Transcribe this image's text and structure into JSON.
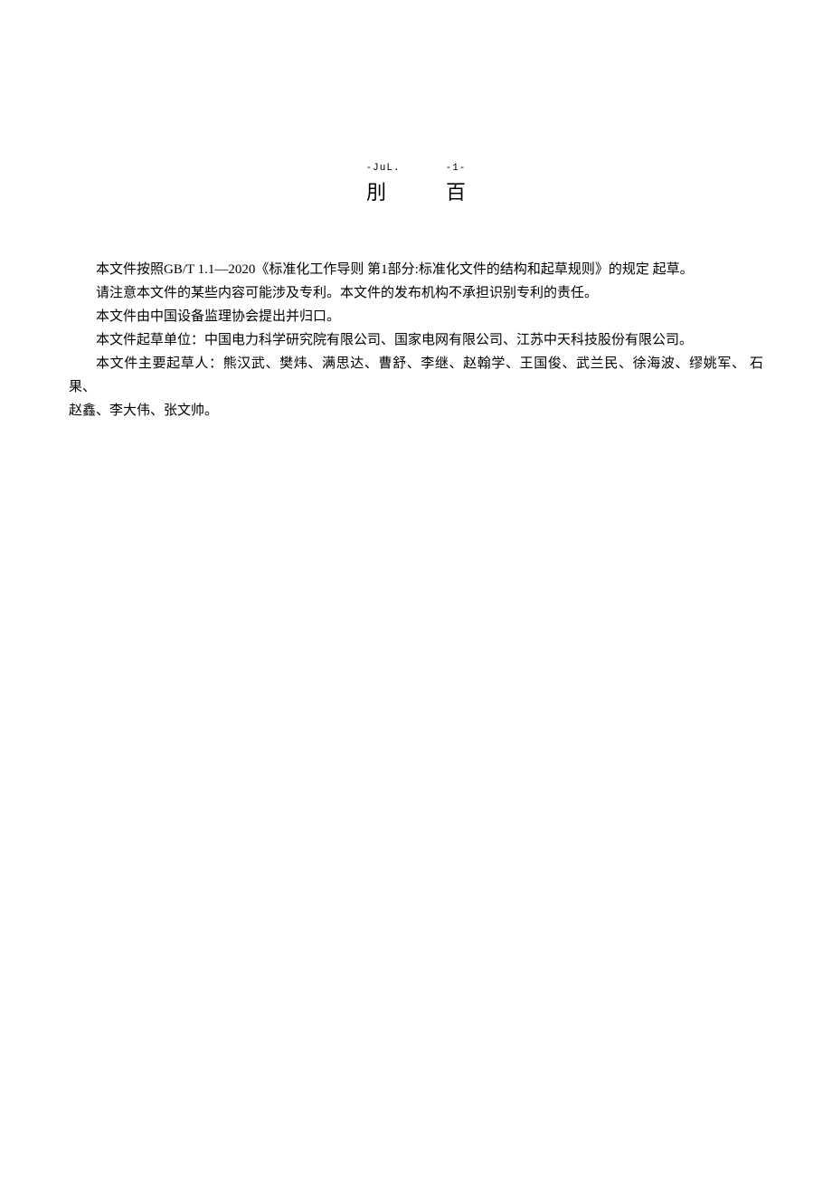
{
  "header": {
    "leftSmall": "-JuL.",
    "rightSmall": "-1-",
    "leftBig": "刖",
    "rightBig": "百"
  },
  "paragraphs": {
    "p1": "本文件按照GB/T 1.1—2020《标准化工作导则 第1部分:标准化文件的结构和起草规则》的规定 起草。",
    "p2": "请注意本文件的某些内容可能涉及专利。本文件的发布机构不承担识别专利的责任。",
    "p3": "本文件由中国设备监理协会提出并归口。",
    "p4": "本文件起草单位：中国电力科学研究院有限公司、国家电网有限公司、江苏中天科技股份有限公司。",
    "p5": "本文件主要起草人：熊汉武、樊炜、满思达、曹舒、李继、赵翰学、王国俊、武兰民、徐海波、缪姚军、 石果、",
    "p6": "赵鑫、李大伟、张文帅。"
  }
}
